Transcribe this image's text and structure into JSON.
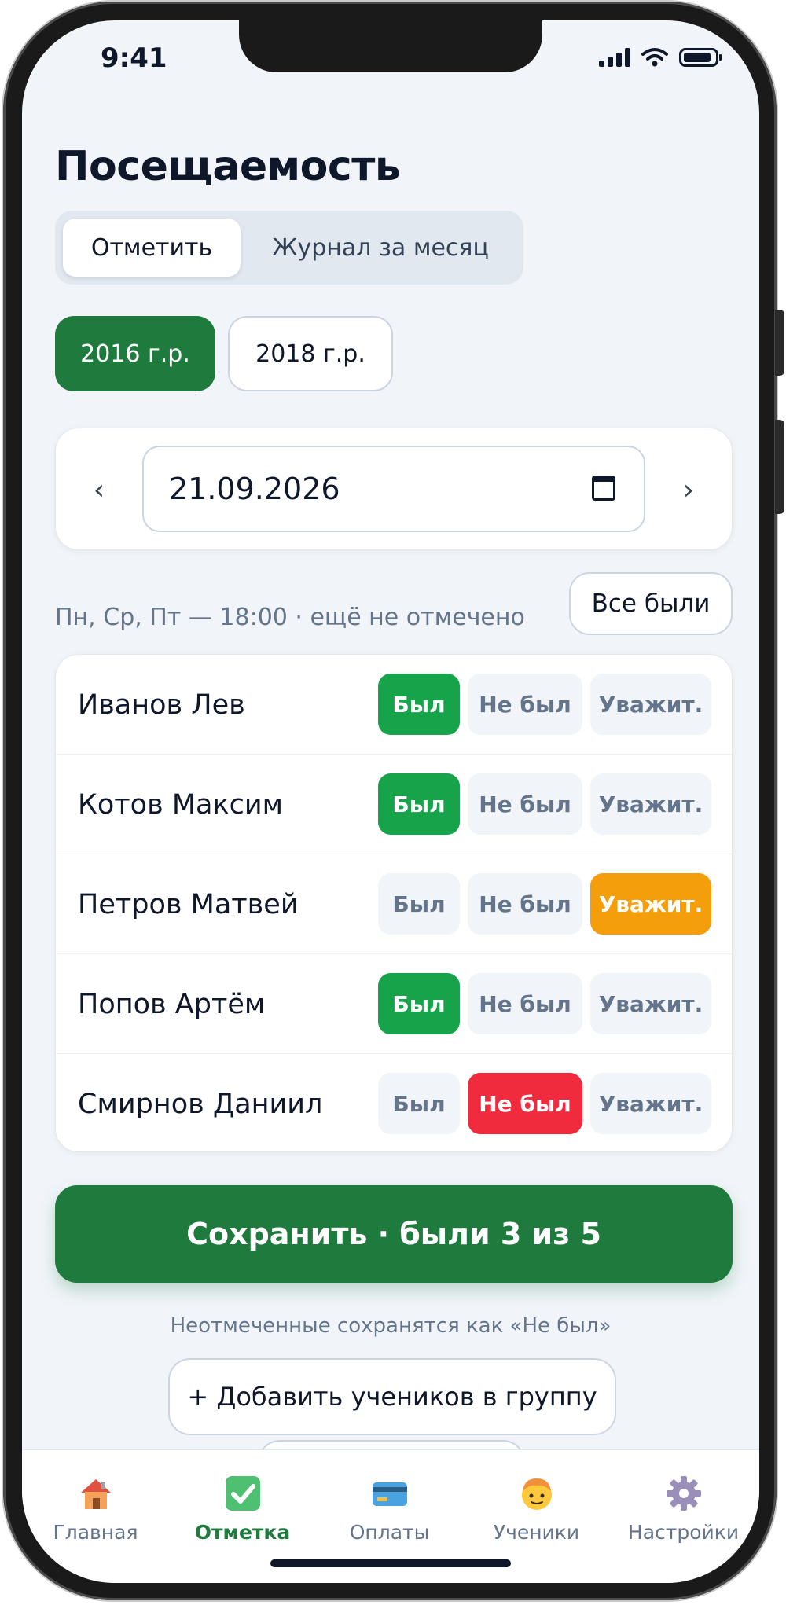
{
  "status_bar": {
    "time": "9:41"
  },
  "page": {
    "title": "Посещаемость"
  },
  "segmented": {
    "tabs": [
      {
        "label": "Отметить",
        "active": true
      },
      {
        "label": "Журнал за месяц",
        "active": false
      }
    ]
  },
  "groups": [
    {
      "label": "2016 г.р.",
      "selected": true
    },
    {
      "label": "2018 г.р.",
      "selected": false
    }
  ],
  "date_picker": {
    "prev": "‹",
    "next": "›",
    "value": "21.09.2026"
  },
  "schedule_info": "Пн, Ср, Пт — 18:00 · ещё не отмечено",
  "all_present_button": "Все были",
  "attendance_options": {
    "present": "Был",
    "absent": "Не был",
    "excused": "Уважит."
  },
  "students": [
    {
      "name": "Иванов Лев",
      "status": "present"
    },
    {
      "name": "Котов Максим",
      "status": "present"
    },
    {
      "name": "Петров Матвей",
      "status": "excused"
    },
    {
      "name": "Попов Артём",
      "status": "present"
    },
    {
      "name": "Смирнов Даниил",
      "status": "absent"
    }
  ],
  "save_button": "Сохранить · были 3 из 5",
  "hint": "Неотмеченные сохранятся как «Не был»",
  "add_students_button": "+ Добавить учеников в группу",
  "tabbar": [
    {
      "label": "Главная",
      "icon": "house-icon",
      "active": false
    },
    {
      "label": "Отметка",
      "icon": "checkmark-icon",
      "active": true
    },
    {
      "label": "Оплаты",
      "icon": "credit-card-icon",
      "active": false
    },
    {
      "label": "Ученики",
      "icon": "student-face-icon",
      "active": false
    },
    {
      "label": "Настройки",
      "icon": "gear-icon",
      "active": false
    }
  ],
  "colors": {
    "brand": "#1f7a3d",
    "present": "#16a34a",
    "absent": "#ef2b3d",
    "excused": "#f59e0b"
  }
}
